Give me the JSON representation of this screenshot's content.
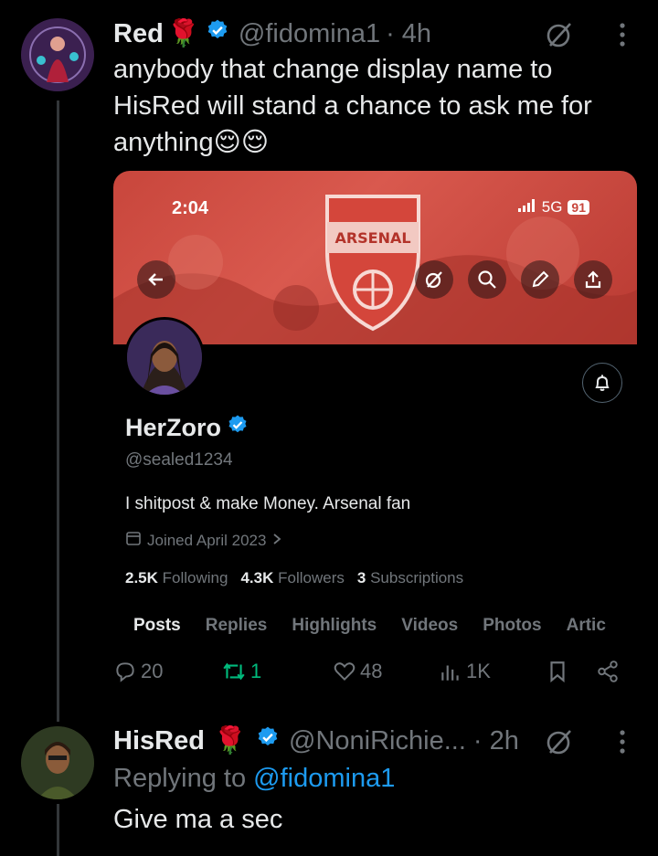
{
  "tweet1": {
    "name": "Red",
    "handle": "@fidomina1",
    "time": "· 4h",
    "text": "anybody that change display name to HisRed will stand a chance to ask me for anything😌😌"
  },
  "quoted_screenshot": {
    "status_time": "2:04",
    "status_network": "5G",
    "status_battery": "91",
    "banner_club": "ARSENAL",
    "profile_name": "HerZoro",
    "profile_handle": "@sealed1234",
    "bio": "I shitpost & make Money. Arsenal fan",
    "joined": "Joined April 2023",
    "following_count": "2.5K",
    "following_label": "Following",
    "followers_count": "4.3K",
    "followers_label": "Followers",
    "subs_count": "3",
    "subs_label": "Subscriptions",
    "tabs": [
      "Posts",
      "Replies",
      "Highlights",
      "Videos",
      "Photos",
      "Artic"
    ]
  },
  "actions": {
    "replies": "20",
    "reposts": "1",
    "likes": "48",
    "views": "1K"
  },
  "tweet2": {
    "name": "HisRed",
    "handle": "@NoniRichie...",
    "time": "· 2h",
    "replying_prefix": "Replying to",
    "replying_to": "@fidomina1",
    "text": "Give ma a sec"
  },
  "colors": {
    "accent": "#1d9bf0",
    "repost_green": "#00ba7c",
    "banner_red": "#c8463c"
  }
}
